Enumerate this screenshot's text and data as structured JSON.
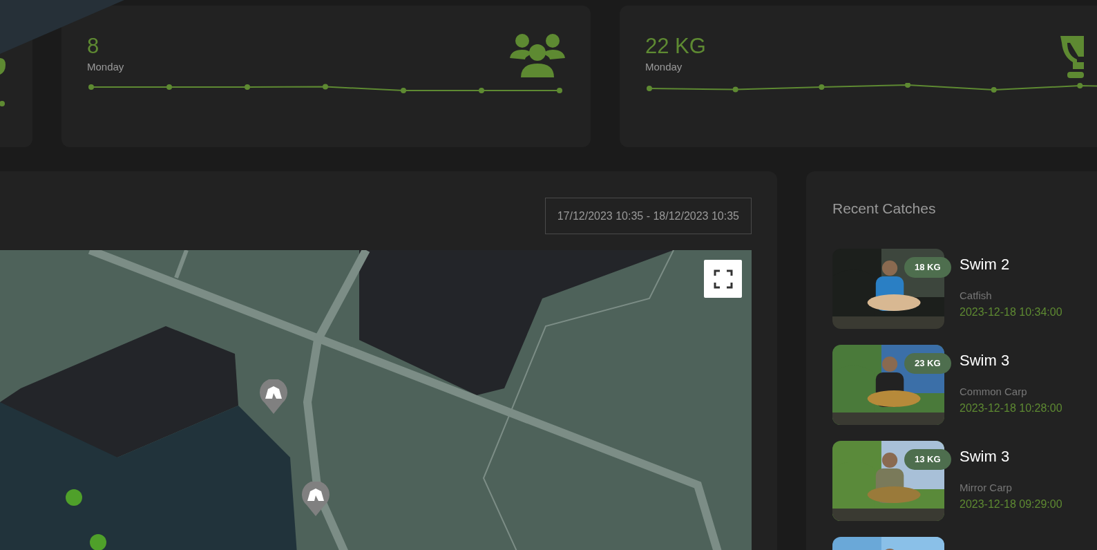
{
  "stat_cards": [
    {
      "kind": "people",
      "value": "8",
      "label": "Monday"
    },
    {
      "kind": "trophy",
      "value": "22 KG",
      "label": "Monday"
    }
  ],
  "map_panel": {
    "date_range": "17/12/2023 10:35 - 18/12/2023 10:35",
    "markers": [
      {
        "kind": "tent"
      },
      {
        "kind": "tent"
      }
    ]
  },
  "recent_catches": {
    "title": "Recent Catches",
    "items": [
      {
        "weight": "18 KG",
        "swim": "Swim 2",
        "species": "Catfish",
        "time": "2023-12-18 10:34:00",
        "photo": {
          "kind": "picture"
        }
      },
      {
        "weight": "23 KG",
        "swim": "Swim 3",
        "species": "Common Carp",
        "time": "2023-12-18 10:28:00",
        "photo": {
          "kind": "picture"
        }
      },
      {
        "weight": "13 KG",
        "swim": "Swim 3",
        "species": "Mirror Carp",
        "time": "2023-12-18 09:29:00",
        "photo": {
          "kind": "picture"
        }
      },
      {
        "photo": {
          "kind": "picture"
        }
      }
    ]
  }
}
